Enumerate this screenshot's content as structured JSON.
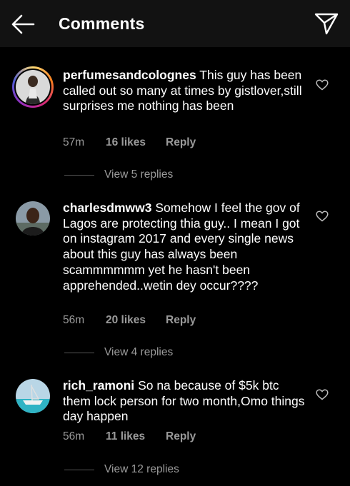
{
  "header": {
    "title": "Comments",
    "back_icon": "arrow-left-icon",
    "send_icon": "paper-plane-icon",
    "background": "#121212"
  },
  "comments": [
    {
      "username": "perfumesandcolognes",
      "text": "This guy has been called out  so many at times by gistlover,still surprises me nothing has been",
      "time": "57m",
      "likes": "16 likes",
      "reply": "Reply",
      "view_replies": "View 5 replies",
      "avatar_has_story_ring": true
    },
    {
      "username": "charlesdmww3",
      "text": "Somehow I feel the gov of  Lagos are protecting thia guy.. I mean I got on instagram 2017 and every single news about this guy has always been scammmmmm  yet he hasn't been apprehended..wetin dey occur????",
      "time": "56m",
      "likes": "20 likes",
      "reply": "Reply",
      "view_replies": "View 4 replies",
      "avatar_has_story_ring": false
    },
    {
      "username": "rich_ramoni",
      "text": "So na because of $5k btc them lock person for two month,Omo things day happen",
      "time": "56m",
      "likes": "11 likes",
      "reply": "Reply",
      "view_replies": "View 12 replies",
      "avatar_has_story_ring": false
    }
  ],
  "colors": {
    "background": "#000000",
    "secondary_text": "#9a9a9a",
    "divider": "#555555"
  }
}
